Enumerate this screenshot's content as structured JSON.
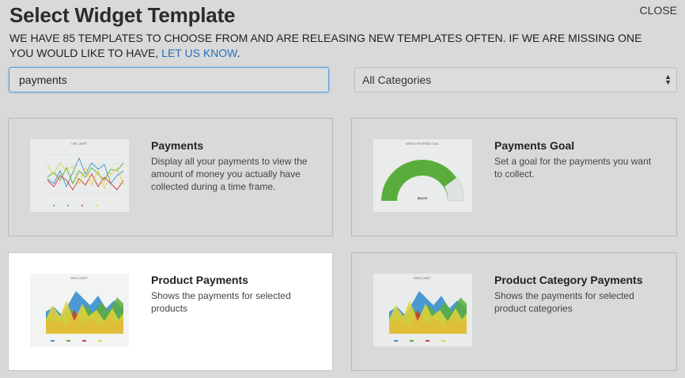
{
  "header": {
    "title": "Select Widget Template",
    "close_label": "CLOSE",
    "subtitle_text": "WE HAVE 85 TEMPLATES TO CHOOSE FROM AND ARE RELEASING NEW TEMPLATES OFTEN. IF WE ARE MISSING ONE YOU WOULD LIKE TO HAVE,",
    "subtitle_link": "LET US KNOW",
    "subtitle_end": "."
  },
  "search": {
    "value": "payments"
  },
  "category_select": {
    "selected": "All Categories"
  },
  "templates": [
    {
      "name": "Payments",
      "description": "Display all your payments to view the amount of money you actually have collected during a time frame.",
      "thumbnail": "line-chart",
      "thumb_title": "LINE CHART",
      "selected": false
    },
    {
      "name": "Payments Goal",
      "description": "Set a goal for the payments you want to collect.",
      "thumbnail": "gauge-chart",
      "thumb_title": "WEEKLY REVENUE GOAL",
      "thumb_value": "$9,676",
      "selected": false
    },
    {
      "name": "Product Payments",
      "description": "Shows the payments for selected products",
      "thumbnail": "area-chart",
      "thumb_title": "AREA CHART",
      "selected": true
    },
    {
      "name": "Product Category Payments",
      "description": "Shows the payments for selected product categories",
      "thumbnail": "area-chart",
      "thumb_title": "AREA CHART",
      "selected": false
    }
  ],
  "colors": {
    "link": "#2a6fb8",
    "focus_border": "#5b9bd5",
    "gauge_fill": "#5aad3c"
  }
}
